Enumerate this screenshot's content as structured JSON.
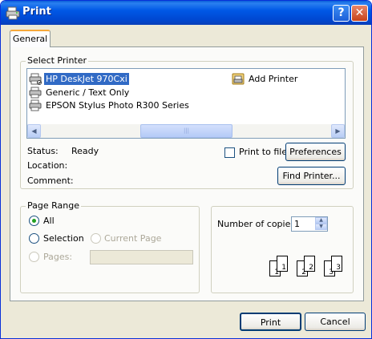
{
  "window": {
    "title": "Print",
    "help_label": "?",
    "close_label": "✕"
  },
  "tabs": [
    {
      "label": "General"
    }
  ],
  "select_printer": {
    "group_label": "Select Printer",
    "printers": [
      {
        "label": "HP DeskJet 970Cxi",
        "selected": true
      },
      {
        "label": "Generic / Text Only",
        "selected": false
      },
      {
        "label": "EPSON Stylus Photo R300 Series",
        "selected": false
      },
      {
        "label": "Add Printer",
        "selected": false
      }
    ],
    "scroll_left": "◀",
    "scroll_right": "▶",
    "scroll_grip": "|||"
  },
  "status": {
    "status_label": "Status:",
    "status_value": "Ready",
    "location_label": "Location:",
    "comment_label": "Comment:"
  },
  "print_to_file_label": "Print to file",
  "preferences_label": "Preferences",
  "find_printer_label": "Find Printer...",
  "page_range": {
    "group_label": "Page Range",
    "all_label": "All",
    "selection_label": "Selection",
    "current_page_label": "Current Page",
    "pages_label": "Pages:",
    "pages_value": ""
  },
  "copies": {
    "label": "Number of copies:",
    "value": "1",
    "spin_up": "▲",
    "spin_down": "▼",
    "collate_pages": [
      "1",
      "1",
      "2",
      "2",
      "3",
      "3"
    ]
  },
  "buttons": {
    "print": "Print",
    "cancel": "Cancel"
  },
  "colors": {
    "titlebar": "#0058e6",
    "selection": "#316ac5",
    "dialog_bg": "#ece9d8"
  }
}
